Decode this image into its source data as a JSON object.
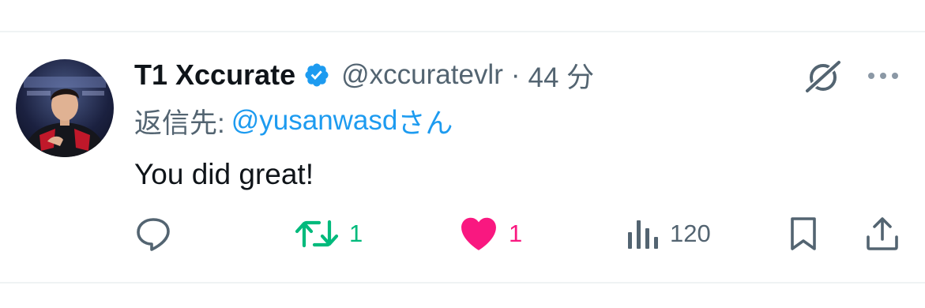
{
  "tweet": {
    "author": {
      "display_name": "T1 Xccurate",
      "verified": true,
      "handle": "@xccuratevlr",
      "separator": "·",
      "time": "44 分"
    },
    "reply_to": {
      "prefix": "返信先:",
      "handle": "@yusanwasd",
      "suffix": "さん"
    },
    "text": "You did great!",
    "actions": {
      "replies": "",
      "retweets": "1",
      "likes": "1",
      "views": "120"
    }
  },
  "colors": {
    "accent": "#1d9bf0",
    "retweet": "#00ba7c",
    "like": "#f91880",
    "muted": "#536471",
    "text": "#0f1419",
    "divider": "#eff3f4"
  },
  "icons": [
    "avatar",
    "verified-badge-icon",
    "grok-icon",
    "more-icon",
    "reply-icon",
    "retweet-icon",
    "like-heart-icon",
    "views-icon",
    "bookmark-icon",
    "share-icon"
  ]
}
